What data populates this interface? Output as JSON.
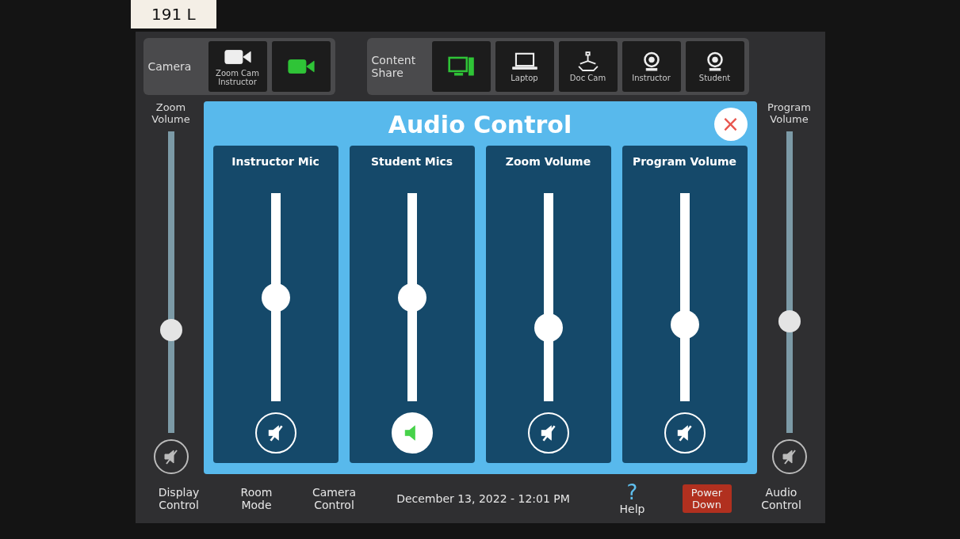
{
  "sticker": "191 L",
  "top_bar": {
    "groups": [
      {
        "label": "Camera",
        "tiles": [
          {
            "kind": "camera",
            "label": "Zoom Cam Instructor",
            "selected": false
          },
          {
            "kind": "camera",
            "selected": true
          }
        ]
      },
      {
        "label": "Content Share",
        "tiles": [
          {
            "kind": "monitor",
            "selected": true
          },
          {
            "kind": "laptop",
            "label": "Laptop",
            "selected": false
          },
          {
            "kind": "doccam",
            "label": "Doc Cam",
            "selected": false
          },
          {
            "kind": "webcam",
            "label": "Instructor",
            "selected": false
          },
          {
            "kind": "webcam",
            "label": "Student",
            "selected": false
          }
        ]
      }
    ]
  },
  "side_sliders": [
    {
      "label": "Zoom Volume",
      "level": 0.33,
      "muted": true
    },
    {
      "label": "Program Volume",
      "level": 0.36,
      "muted": true
    }
  ],
  "dialog": {
    "title": "Audio Control",
    "close": "×",
    "channels": [
      {
        "name": "Instructor Mic",
        "level": 0.5,
        "muted": true
      },
      {
        "name": "Student Mics",
        "level": 0.5,
        "muted": false
      },
      {
        "name": "Zoom Volume",
        "level": 0.33,
        "muted": true
      },
      {
        "name": "Program Volume",
        "level": 0.35,
        "muted": true
      }
    ]
  },
  "bottom_bar": [
    {
      "kind": "nav",
      "label": "Display Control"
    },
    {
      "kind": "nav",
      "label": "Room Mode"
    },
    {
      "kind": "nav",
      "label": "Camera Control"
    },
    {
      "kind": "date",
      "label": "December 13, 2022 - 12:01 PM"
    },
    {
      "kind": "help",
      "icon": "?",
      "label": "Help"
    },
    {
      "kind": "power",
      "label": "Power Down"
    },
    {
      "kind": "nav",
      "label": "Audio Control"
    }
  ]
}
